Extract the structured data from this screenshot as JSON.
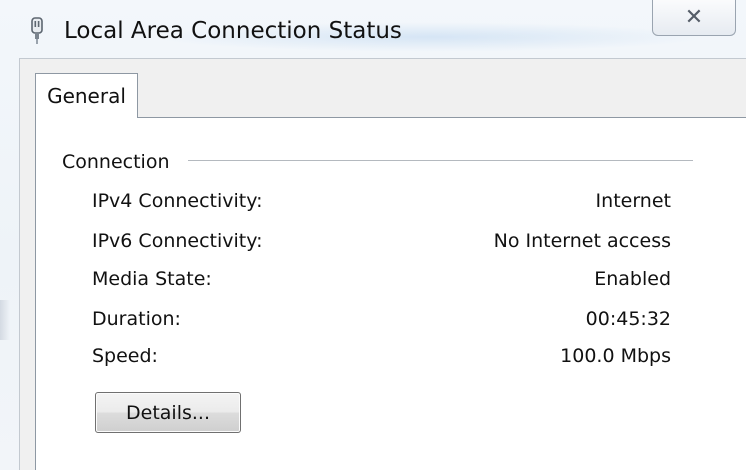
{
  "window": {
    "title": "Local Area Connection Status",
    "icon": "network-adapter-icon",
    "close_glyph": "✕"
  },
  "tabs": [
    {
      "label": "General",
      "selected": true
    }
  ],
  "connection": {
    "group_label": "Connection",
    "rows": [
      {
        "label": "IPv4 Connectivity:",
        "value": "Internet"
      },
      {
        "label": "IPv6 Connectivity:",
        "value": "No Internet access"
      },
      {
        "label": "Media State:",
        "value": "Enabled"
      },
      {
        "label": "Duration:",
        "value": "00:45:32"
      },
      {
        "label": "Speed:",
        "value": "100.0 Mbps"
      }
    ]
  },
  "buttons": {
    "details_label": "Details..."
  },
  "colors": {
    "accent": "#8e98a3",
    "panel_background": "#ffffff",
    "window_background": "#eef3f8"
  }
}
